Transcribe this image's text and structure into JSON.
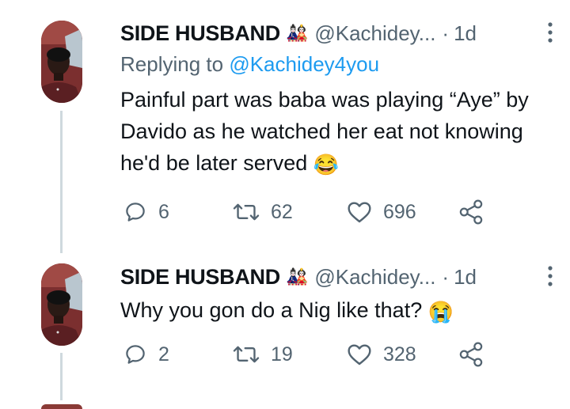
{
  "tweets": [
    {
      "name": "SIDE HUSBAND",
      "badge": "🎎",
      "handle": "@Kachidey...",
      "separator": "·",
      "time": "1d",
      "reply_label": "Replying to",
      "reply_mention": "@Kachidey4you",
      "text": "Painful part was baba was playing “Aye” by Davido as he watched her eat not knowing he'd be later served",
      "emoji": "😂",
      "replies": "6",
      "retweets": "62",
      "likes": "696"
    },
    {
      "name": "SIDE HUSBAND",
      "badge": "🎎",
      "handle": "@Kachidey...",
      "separator": "·",
      "time": "1d",
      "text": "Why you gon do a Nig like that?",
      "emoji": "😭",
      "replies": "2",
      "retweets": "19",
      "likes": "328"
    }
  ],
  "icons": {
    "reply": "reply-icon",
    "retweet": "retweet-icon",
    "like": "heart-icon",
    "share": "share-icon",
    "more": "more-vertical-icon"
  },
  "colors": {
    "text": "#0f1419",
    "muted": "#536471",
    "link": "#1d9bf0",
    "thread_line": "#cfd9de"
  }
}
